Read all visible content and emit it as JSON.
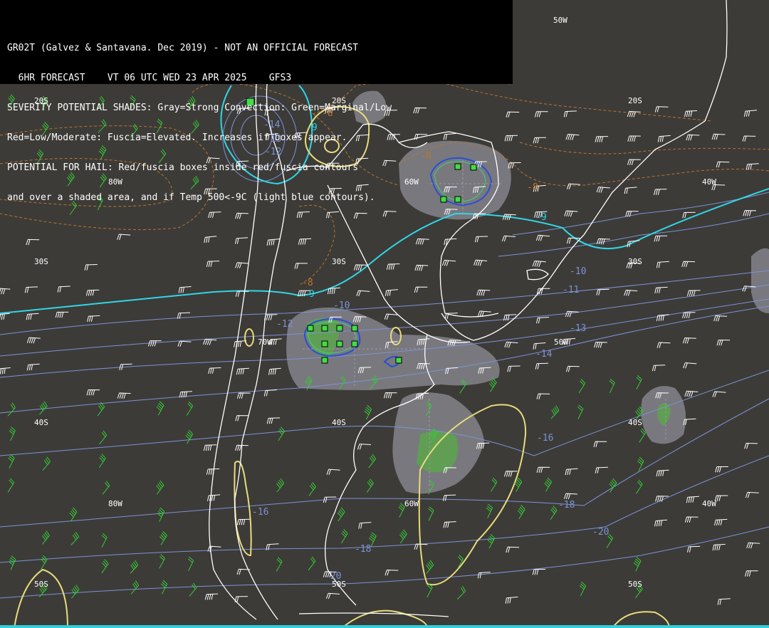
{
  "header": {
    "line1": "GR02T (Galvez & Santavana. Dec 2019) - NOT AN OFFICIAL FORECAST",
    "line2": "  6HR FORECAST    VT 06 UTC WED 23 APR 2025    GFS3",
    "line3": "SEVERITY POTENTIAL SHADES: Gray=Strong Convection: Green=Marginal/Low",
    "line4": "Red=Low/Moderate: Fuscia=Elevated. Increases if boxes appear.",
    "line5": "POTENTIAL FOR HAIL: Red/fuscia boxes inside red/fuscia contours",
    "line6": "and over a shaded area, and if Temp 500<-9C (light blue contours)."
  },
  "grid_labels": {
    "lon_50w_top": "50W",
    "lat_20s_a": "20S",
    "lat_20s_b": "20S",
    "lat_20s_c": "20S",
    "lon_80w": "80W",
    "lon_60w_a": "60W",
    "lon_40w_a": "40W",
    "lat_30s_a": "30S",
    "lat_30s_b": "30S",
    "lat_30s_c": "30S",
    "lon_70w": "70W",
    "lon_50w": "50W",
    "lat_40s_a": "40S",
    "lat_40s_b": "40S",
    "lat_40s_c": "40S",
    "lon_80w_b": "80W",
    "lon_60w_b": "60W",
    "lon_40w_b": "40W",
    "lat_50s_a": "50S",
    "lat_50s_b": "50S",
    "lat_50s_c": "50S"
  },
  "contour_labels": {
    "t_neg9_a": "-9",
    "t_neg9_b": "-9",
    "t_neg9_c": "-9",
    "t_neg14": "-14",
    "t_neg13": "-13",
    "t_neg12": "-12",
    "o_neg8_a": "-8",
    "o_neg8_b": "-8",
    "o_neg8_c": "-8",
    "o_neg8_d": "-8",
    "t_neg10_a": "-10",
    "t_neg10_b": "-10",
    "t_neg11": "-11",
    "t_neg12_b": "-12",
    "t_neg13_b": "-13",
    "t_neg14_b": "-14",
    "t_neg16_a": "-16",
    "t_neg16_b": "-16",
    "t_neg18_a": "-18",
    "t_neg18_b": "-18",
    "t_neg20_a": "-20",
    "t_neg20_b": "-20"
  },
  "colors": {
    "background": "#3d3b38",
    "coast": "#ffffff",
    "temp_contour": "#7b93d6",
    "cold_contour": "#2fd7e6",
    "dashed_contour": "#b7762c",
    "yellow_contour": "#e8dc7a",
    "severity_gray": "#8e8e95",
    "severity_green": "#5aa84a",
    "hail_box": "#44dd44",
    "wind_barb": "#ffffff",
    "wind_barb_green": "#33cc33"
  }
}
